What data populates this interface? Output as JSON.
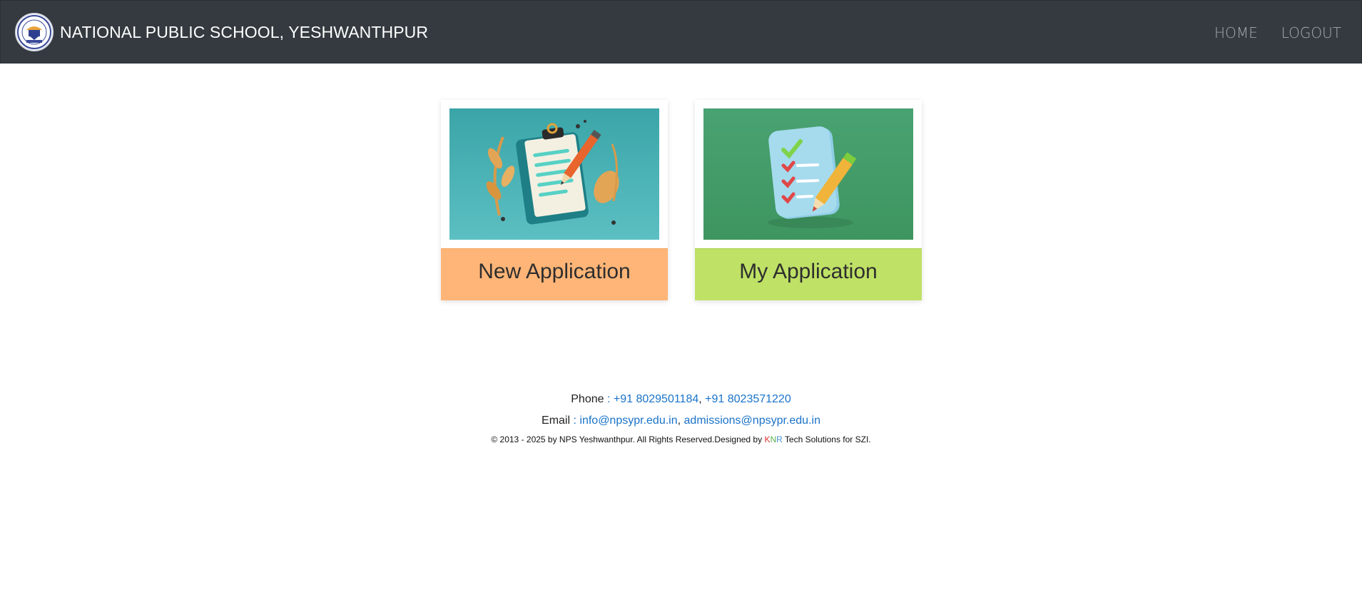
{
  "navbar": {
    "brand_name": "NATIONAL PUBLIC SCHOOL, YESHWANTHPUR",
    "links": [
      "HOME",
      "LOGOUT"
    ],
    "bg_color": "#343a40"
  },
  "cards": [
    {
      "label": "New Application",
      "image_icon": "clipboard-pencil-illustration",
      "color": "#ffb577"
    },
    {
      "label": "My Application",
      "image_icon": "checklist-pencil-illustration",
      "color": "#bfe166"
    }
  ],
  "footer": {
    "phone_label": "Phone",
    "phone_sep": " : ",
    "phones": [
      "+91 8029501184",
      "+91 8023571220"
    ],
    "email_label": "Email",
    "email_sep": " : ",
    "emails": [
      "info@npsypr.edu.in",
      "admissions@npsypr.edu.in"
    ],
    "list_sep": ",",
    "copyright_prefix": "© 2013 - 2025 by NPS Yeshwanthpur. All Rights Reserved.Designed by ",
    "designer_k": "K",
    "designer_n": "N",
    "designer_r": "R",
    "copyright_suffix": " Tech Solutions for SZI."
  }
}
